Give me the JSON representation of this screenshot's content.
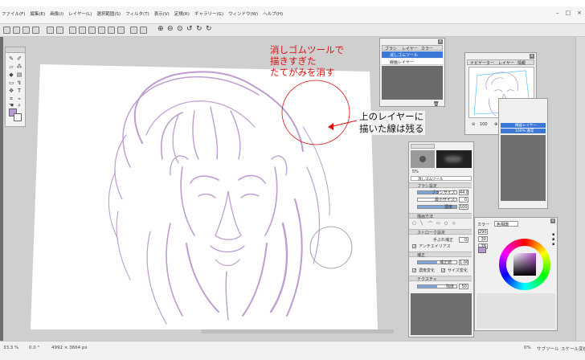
{
  "menu": {
    "items": [
      "ファイル(F)",
      "編集(E)",
      "画像(I)",
      "レイヤー(L)",
      "選択範囲(S)",
      "フィルタ(T)",
      "表示(V)",
      "定規(R)",
      "ギャラリー(G)",
      "ウィンドウ(W)",
      "ヘルプ(H)"
    ],
    "window_controls": [
      "–",
      "□",
      "×"
    ]
  },
  "brush_panel": {
    "tabs": [
      "ブラシ",
      "レイヤー",
      "カラー"
    ],
    "layers": [
      "消しゴムツール",
      "線画レイヤー"
    ]
  },
  "navigator_panel": {
    "tabs": [
      "ナビゲーター",
      "レイヤー",
      "情報"
    ],
    "zoom_value": "100"
  },
  "layer_panel2": {
    "layers": [
      "線画レイヤー",
      "100% 通常"
    ]
  },
  "tool_props": {
    "tool_name": "消しゴムツール",
    "size_pct": "5%",
    "section_brush": "ブラシ設定",
    "label_size": "ブラシサイズ",
    "value_size": "44.0",
    "label_min": "最小サイズ",
    "value_min": "0",
    "label_density": "濃度",
    "value_density": "100",
    "section_draw": "描画方法",
    "section_stroke": "ストローク設定",
    "label_hand": "手ぶれ補正",
    "value_hand": "0",
    "label_antialias": "アンチエイリアス",
    "section_correct": "補正",
    "label_correct": "補正値",
    "value_correct": "1.00",
    "label_density_change": "濃度変化",
    "label_size_change": "サイズ変化",
    "section_texture": "テクスチャ",
    "label_strength": "強度",
    "value_strength": "50",
    "size_fill": 0.55,
    "min_fill": 0.0,
    "density_fill": 1.0,
    "correct_fill": 0.5,
    "strength_fill": 0.5
  },
  "color_panel": {
    "title": "カラー",
    "mode": "色相環",
    "values": [
      "290",
      "30",
      "78"
    ]
  },
  "annotations": {
    "eraser_lines": [
      "消しゴムツールで",
      "描きすぎた",
      "たてがみを消す"
    ],
    "upper_layer_lines": [
      "上のレイヤーに",
      "描いた線は残る"
    ]
  },
  "status": {
    "zoom": "33.3 %",
    "angle": "0.0 °",
    "size": "4992 × 3664 px",
    "left_value": "0%",
    "mid_value": "サブツール",
    "right_value": "スケール変換"
  },
  "colors": {
    "line_color": "#a86fbf",
    "annotation_red": "#dd1111",
    "selected_blue": "#3c78d8"
  }
}
